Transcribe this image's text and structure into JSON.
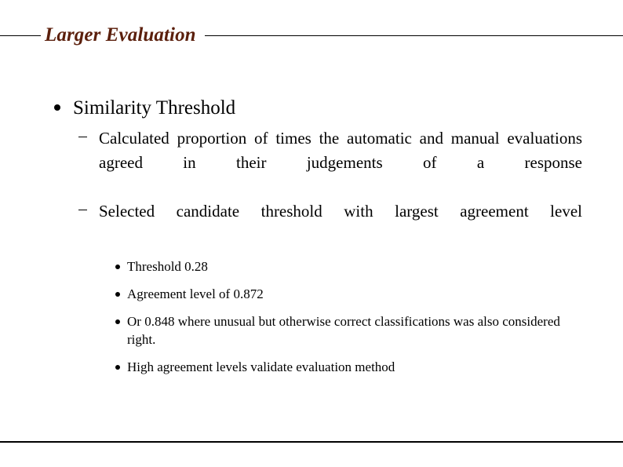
{
  "slide": {
    "title": "Larger Evaluation",
    "title_color": "#5b1f0c",
    "background_color": "#ffffff",
    "text_color": "#000000",
    "rule_color": "#000000"
  },
  "content": {
    "level1": [
      {
        "text": "Similarity Threshold",
        "marker": "filled-circle-bullet"
      }
    ],
    "level2": [
      {
        "text": "Calculated proportion of times the automatic and manual evaluations agreed in their judgements of a response",
        "marker": "en-dash-bullet"
      },
      {
        "text": "Selected candidate threshold with largest agreement level",
        "marker": "en-dash-bullet"
      }
    ],
    "level3": [
      {
        "text": "Threshold 0.28",
        "marker": "filled-circle-bullet"
      },
      {
        "text": "Agreement level of 0.872",
        "marker": "filled-circle-bullet"
      },
      {
        "text": "Or 0.848 where unusual but otherwise correct classifications was also considered right.",
        "marker": "filled-circle-bullet"
      },
      {
        "text": "High agreement levels validate evaluation method",
        "marker": "filled-circle-bullet"
      }
    ]
  }
}
